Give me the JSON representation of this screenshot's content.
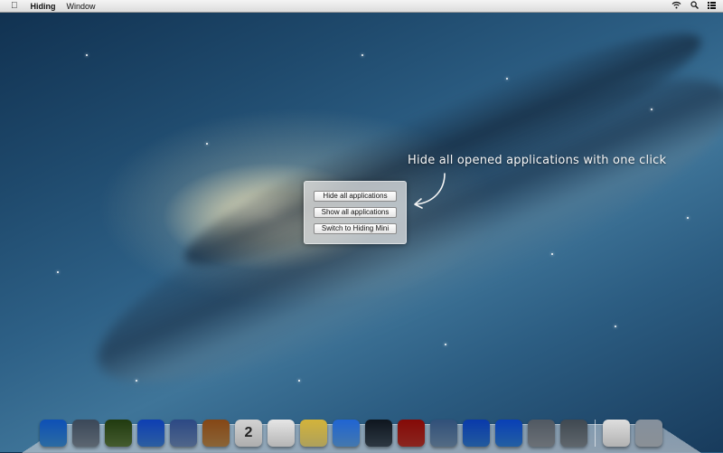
{
  "menubar": {
    "app_name": "Hiding",
    "items": [
      "Window"
    ]
  },
  "panel": {
    "buttons": [
      {
        "label": "Hide all applications"
      },
      {
        "label": "Show all applications"
      },
      {
        "label": "Switch to Hiding Mini"
      }
    ]
  },
  "annotation": {
    "text": "Hide all opened applications with one click"
  },
  "dock": {
    "apps": [
      {
        "icon": "finder-icon",
        "color": "#3a8fd8"
      },
      {
        "icon": "launchpad-icon",
        "color": "#7a8796"
      },
      {
        "icon": "mission-control-icon",
        "color": "#5b7a3e"
      },
      {
        "icon": "safari-icon",
        "color": "#3b7ed6"
      },
      {
        "icon": "mail-icon",
        "color": "#6a88b8"
      },
      {
        "icon": "contacts-icon",
        "color": "#b8864a"
      },
      {
        "icon": "calendar-icon",
        "color": "#e8e8e8",
        "text": "2"
      },
      {
        "icon": "reminders-icon",
        "color": "#f2f2f2"
      },
      {
        "icon": "notes-icon",
        "color": "#e8d67a"
      },
      {
        "icon": "messages-icon",
        "color": "#5aa0e8"
      },
      {
        "icon": "facetime-icon",
        "color": "#3c4a58"
      },
      {
        "icon": "photo-booth-icon",
        "color": "#b8322a"
      },
      {
        "icon": "iphoto-icon",
        "color": "#6f8fb0"
      },
      {
        "icon": "itunes-icon",
        "color": "#2f79d1"
      },
      {
        "icon": "app-store-icon",
        "color": "#2f7fd8"
      },
      {
        "icon": "system-preferences-icon",
        "color": "#8f969e"
      },
      {
        "icon": "hiding-app-icon",
        "color": "#7f8890"
      }
    ],
    "stacks": [
      {
        "icon": "documents-stack-icon",
        "color": "#eeeeee"
      },
      {
        "icon": "trash-icon",
        "color": "#b8c0c8"
      }
    ]
  }
}
